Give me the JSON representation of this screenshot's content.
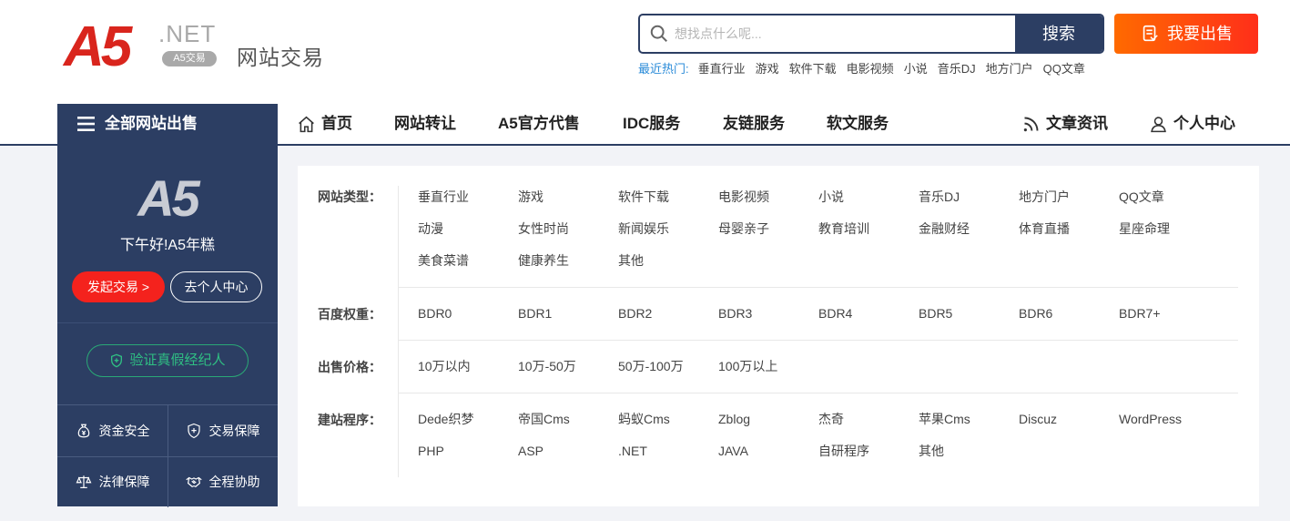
{
  "header": {
    "logo_mark": "A5",
    "logo_net": ".NET",
    "logo_badge": "A5交易",
    "logo_sub": "网站交易",
    "search_placeholder": "想找点什么呢...",
    "search_button": "搜索",
    "sell_button": "我要出售",
    "hot_label": "最近热门:",
    "hot_items": [
      "垂直行业",
      "游戏",
      "软件下载",
      "电影视频",
      "小说",
      "音乐DJ",
      "地方门户",
      "QQ文章"
    ]
  },
  "nav": {
    "all_sites": "全部网站出售",
    "items": [
      "首页",
      "网站转让",
      "A5官方代售",
      "IDC服务",
      "友链服务",
      "软文服务"
    ],
    "right_items": [
      "文章资讯",
      "个人中心"
    ]
  },
  "sidebar": {
    "logo_mark": "A5",
    "greeting": "下午好!A5年糕",
    "start_trade": "发起交易 >",
    "personal_center": "去个人中心",
    "verify_broker": "验证真假经纪人",
    "features": [
      "资金安全",
      "交易保障",
      "法律保障",
      "全程协助"
    ]
  },
  "filters": [
    {
      "label": "网站类型：",
      "options": [
        "垂直行业",
        "游戏",
        "软件下载",
        "电影视频",
        "小说",
        "音乐DJ",
        "地方门户",
        "QQ文章",
        "动漫",
        "女性时尚",
        "新闻娱乐",
        "母婴亲子",
        "教育培训",
        "金融财经",
        "体育直播",
        "星座命理",
        "美食菜谱",
        "健康养生",
        "其他"
      ]
    },
    {
      "label": "百度权重：",
      "options": [
        "BDR0",
        "BDR1",
        "BDR2",
        "BDR3",
        "BDR4",
        "BDR5",
        "BDR6",
        "BDR7+"
      ]
    },
    {
      "label": "出售价格：",
      "options": [
        "10万以内",
        "10万-50万",
        "50万-100万",
        "100万以上"
      ]
    },
    {
      "label": "建站程序：",
      "options": [
        "Dede织梦",
        "帝国Cms",
        "蚂蚁Cms",
        "Zblog",
        "杰奇",
        "苹果Cms",
        "Discuz",
        "WordPress",
        "PHP",
        "ASP",
        ".NET",
        "JAVA",
        "自研程序",
        "其他"
      ]
    }
  ],
  "colors": {
    "navy": "#2c3e63",
    "brand_red": "#d9251d",
    "sell_orange": "#ff6a00",
    "verify_green": "#2fbf83",
    "hot_blue": "#2a8bd8"
  }
}
